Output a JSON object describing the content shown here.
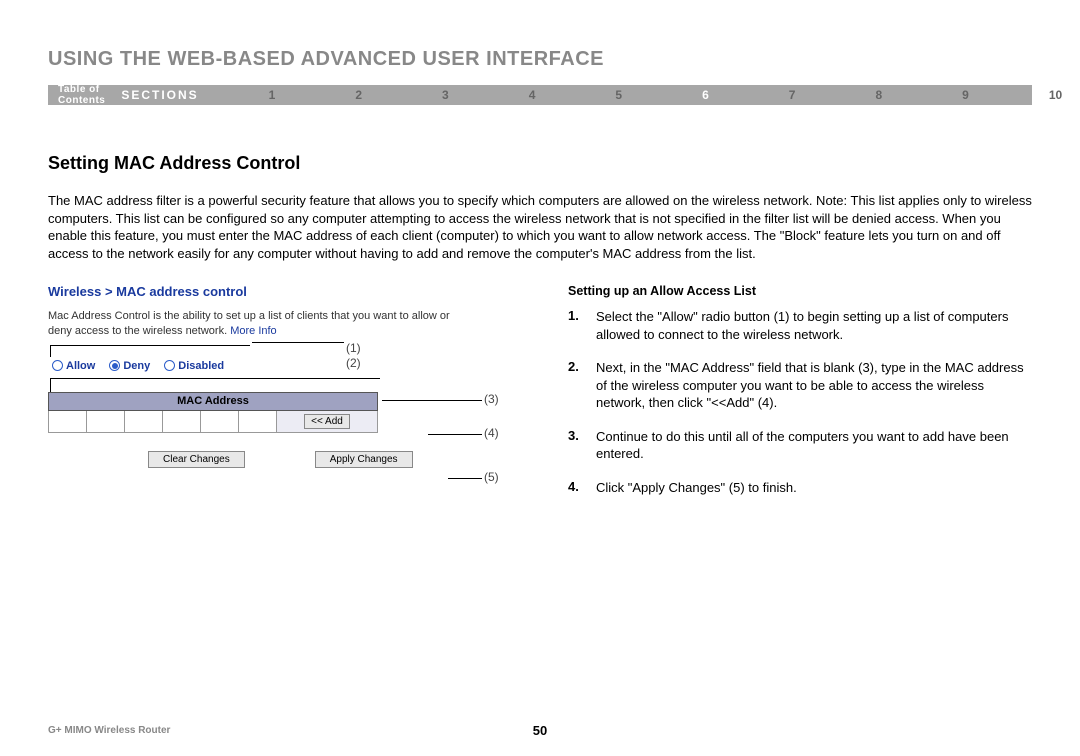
{
  "header": {
    "title": "USING THE WEB-BASED ADVANCED USER INTERFACE",
    "toc_label": "Table of Contents",
    "sections_label": "SECTIONS",
    "section_numbers": [
      "1",
      "2",
      "3",
      "4",
      "5",
      "6",
      "7",
      "8",
      "9",
      "10"
    ],
    "active_section": "6"
  },
  "section": {
    "heading": "Setting MAC Address Control",
    "body": "The MAC address filter is a powerful security feature that allows you to specify which computers are allowed on the wireless network. Note: This list applies only to wireless computers. This list can be configured so any computer attempting to access the wireless network that is not specified in the filter list will be denied access. When you enable this feature, you must enter the MAC address of each client (computer) to which you want to allow network access. The \"Block\" feature lets you turn on and off access to the network easily for any computer without having to add and remove the computer's MAC address from the list."
  },
  "panel": {
    "title": "Wireless > MAC address control",
    "description": "Mac Address Control is the ability to set up a list of clients that you want to allow or deny access to the wireless network.",
    "more_info": "More Info",
    "radio_allow": "Allow",
    "radio_deny": "Deny",
    "radio_disabled": "Disabled",
    "table_header": "MAC Address",
    "add_button": "<< Add",
    "clear_button": "Clear Changes",
    "apply_button": "Apply Changes",
    "callouts": {
      "c1": "(1)",
      "c2": "(2)",
      "c3": "(3)",
      "c4": "(4)",
      "c5": "(5)"
    }
  },
  "right": {
    "heading": "Setting up an Allow Access List",
    "steps": [
      {
        "num": "1.",
        "text": "Select the \"Allow\" radio button (1) to begin setting up a list of computers allowed to connect to the wireless network."
      },
      {
        "num": "2.",
        "text": "Next, in the \"MAC Address\" field that is blank (3), type in the MAC address of the wireless computer you want to be able to access the wireless network, then click \"<<Add\" (4)."
      },
      {
        "num": "3.",
        "text": "Continue to do this until all of the computers you want to add have been entered."
      },
      {
        "num": "4.",
        "text": "Click \"Apply Changes\" (5) to finish."
      }
    ]
  },
  "footer": {
    "product": "G+ MIMO Wireless Router",
    "page_number": "50"
  }
}
